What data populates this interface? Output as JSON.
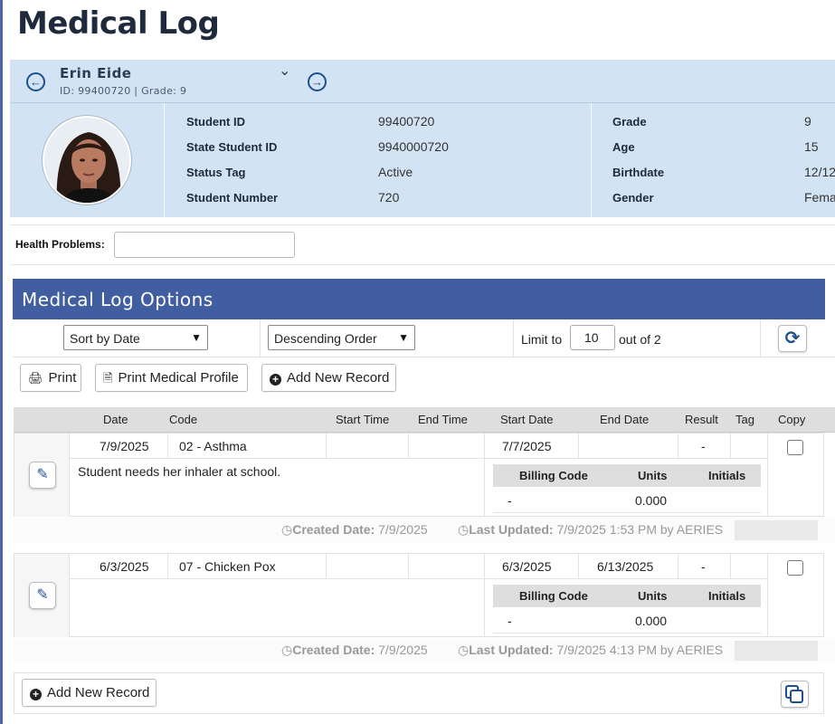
{
  "page_title": "Medical Log",
  "student_nav": {
    "name": "Erin Eide",
    "sub": "ID: 99400720 |  Grade: 9",
    "prev_icon": "arrow-left-circle-icon",
    "next_icon": "arrow-right-circle-icon"
  },
  "student_info": {
    "col1": [
      {
        "label": "Student ID",
        "value": "99400720"
      },
      {
        "label": "State Student ID",
        "value": "9940000720"
      },
      {
        "label": "Status Tag",
        "value": "Active"
      },
      {
        "label": "Student Number",
        "value": "720"
      }
    ],
    "col2": [
      {
        "label": "Grade",
        "value": "9"
      },
      {
        "label": "Age",
        "value": "15"
      },
      {
        "label": "Birthdate",
        "value": "12/12"
      },
      {
        "label": "Gender",
        "value": "Fema"
      }
    ]
  },
  "health_problems": {
    "label": "Health Problems:",
    "value": ""
  },
  "options": {
    "title": "Medical Log Options",
    "sort_select": "Sort by Date",
    "order_select": "Descending Order",
    "limit_label": "Limit to",
    "limit_value": "10",
    "limit_suffix": "out of 2"
  },
  "buttons": {
    "print": "Print",
    "print_profile": "Print Medical Profile",
    "add_new": "Add New Record"
  },
  "table_headers": [
    "Date",
    "Code",
    "Start Time",
    "End Time",
    "Start Date",
    "End Date",
    "Result",
    "Tag",
    "Copy"
  ],
  "billing_headers": [
    "Billing Code",
    "Units",
    "Initials"
  ],
  "records": [
    {
      "date": "7/9/2025",
      "code": "02 - Asthma",
      "start_time": "",
      "end_time": "",
      "start_date": "7/7/2025",
      "end_date": "",
      "result": "-",
      "tag": "",
      "comment": "Student needs her inhaler at school.",
      "billing_code": "-",
      "units": "0.000",
      "initials": "",
      "created_label": "Created Date:",
      "created_value": "7/9/2025",
      "updated_label": "Last Updated:",
      "updated_value": "7/9/2025 1:53 PM by AERIES"
    },
    {
      "date": "6/3/2025",
      "code": "07 - Chicken Pox",
      "start_time": "",
      "end_time": "",
      "start_date": "6/3/2025",
      "end_date": "6/13/2025",
      "result": "-",
      "tag": "",
      "comment": "",
      "billing_code": "-",
      "units": "0.000",
      "initials": "",
      "created_label": "Created Date:",
      "created_value": "7/9/2025",
      "updated_label": "Last Updated:",
      "updated_value": "7/9/2025 4:13 PM by AERIES"
    }
  ],
  "bottom": {
    "add_new": "Add New Record"
  },
  "colors": {
    "header_blue": "#415ea0",
    "panel_blue": "#d2e3f3",
    "icon_blue": "#1f4f8c"
  }
}
